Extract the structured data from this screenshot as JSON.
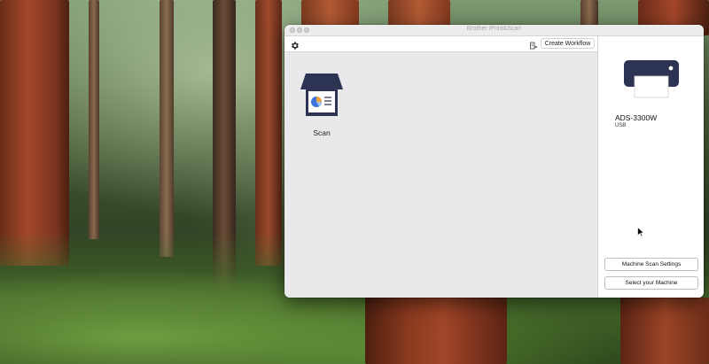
{
  "window": {
    "title": "Brother iPrint&Scan"
  },
  "toolbar": {
    "settings_icon": "gear-icon",
    "workflow_icon": "document-arrow-icon",
    "create_workflow_label": "Create Workflow"
  },
  "main": {
    "tiles": [
      {
        "label": "Scan",
        "icon": "scanner-icon"
      }
    ]
  },
  "sidebar": {
    "device_name": "ADS-3300W",
    "connection": "USB",
    "machine_scan_settings_label": "Machine Scan Settings",
    "select_machine_label": "Select your Machine"
  },
  "colors": {
    "device_body": "#2d3453",
    "pie_blue": "#3b73d9",
    "pie_orange": "#f2a23a"
  }
}
